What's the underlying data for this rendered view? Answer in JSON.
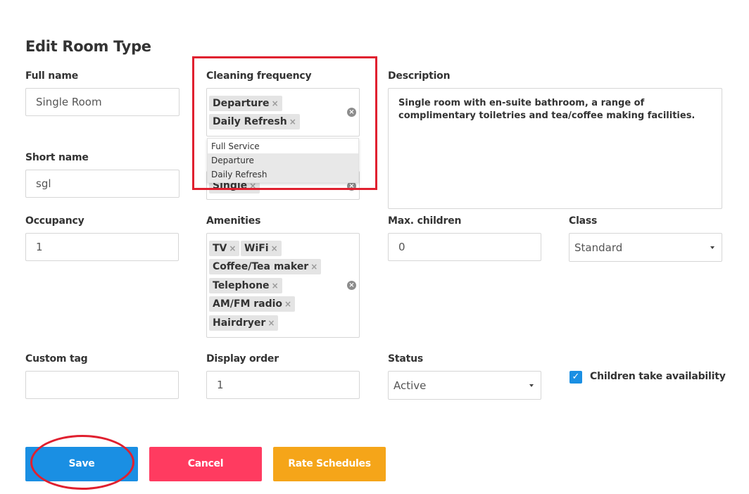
{
  "page": {
    "title": "Edit Room Type"
  },
  "labels": {
    "full_name": "Full name",
    "cleaning_frequency": "Cleaning frequency",
    "description": "Description",
    "short_name": "Short name",
    "occupancy": "Occupancy",
    "amenities": "Amenities",
    "max_children": "Max. children",
    "class": "Class",
    "custom_tag": "Custom tag",
    "display_order": "Display order",
    "status": "Status"
  },
  "fields": {
    "full_name": "Single Room",
    "short_name": "sgl",
    "occupancy": "1",
    "max_children": "0",
    "custom_tag": "",
    "display_order": "1",
    "description": "Single room with en-suite bathroom, a range of complimentary toiletries and tea/coffee making facilities."
  },
  "cleaning_frequency": {
    "tags": [
      "Departure",
      "Daily Refresh"
    ],
    "options": [
      "Full Service",
      "Departure",
      "Daily Refresh"
    ],
    "highlighted": [
      "Departure",
      "Daily Refresh"
    ]
  },
  "bed_type_partial": {
    "tag": "Single"
  },
  "amenities": {
    "tags": [
      "TV",
      "WiFi",
      "Coffee/Tea maker",
      "Telephone",
      "AM/FM radio",
      "Hairdryer"
    ]
  },
  "class_select": {
    "value": "Standard"
  },
  "status_select": {
    "value": "Active"
  },
  "children_take_availability": {
    "label": "Children take availability",
    "checked": true
  },
  "buttons": {
    "save": "Save",
    "cancel": "Cancel",
    "rate_schedules": "Rate Schedules"
  },
  "icons": {
    "remove": "×",
    "clear": "×",
    "check": "✓"
  },
  "colors": {
    "primary": "#1a8fe3",
    "danger": "#ff3b60",
    "warning": "#f5a519",
    "annotation": "#e0202f"
  }
}
